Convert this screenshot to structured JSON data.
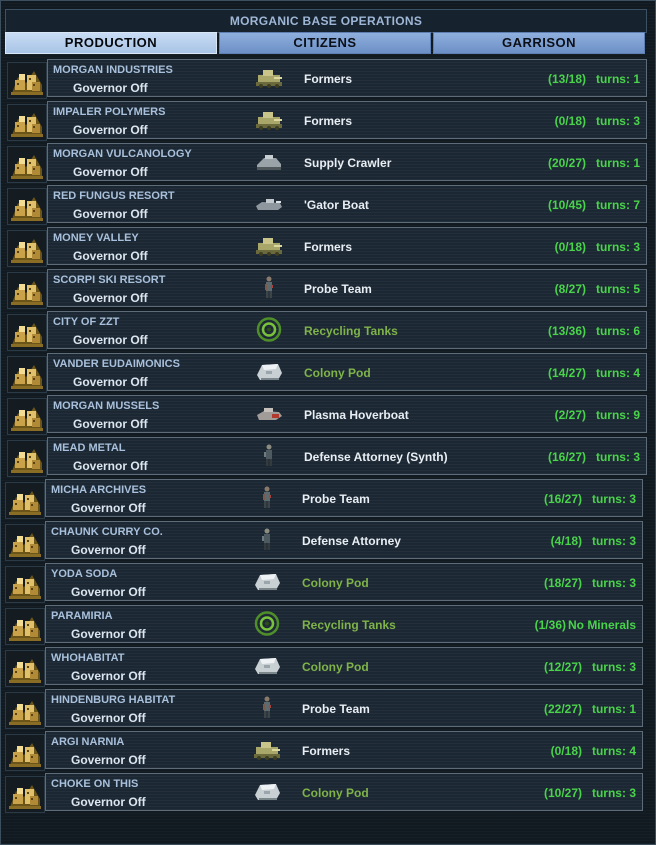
{
  "window": {
    "title": "MORGANIC BASE OPERATIONS"
  },
  "tabs": [
    {
      "label": "PRODUCTION",
      "active": true
    },
    {
      "label": "CITIZENS",
      "active": false
    },
    {
      "label": "GARRISON",
      "active": false
    }
  ],
  "bases": [
    {
      "name": "MORGAN INDUSTRIES",
      "governor": "Governor Off",
      "item": "Formers",
      "item_icon": "formers-icon",
      "facility": false,
      "progress": "(13/18)",
      "turns": "turns:  1"
    },
    {
      "name": "IMPALER POLYMERS",
      "governor": "Governor Off",
      "item": "Formers",
      "item_icon": "formers-icon",
      "facility": false,
      "progress": "(0/18)",
      "turns": "turns:  3"
    },
    {
      "name": "MORGAN VULCANOLOGY",
      "governor": "Governor Off",
      "item": "Supply Crawler",
      "item_icon": "supply-crawler-icon",
      "facility": false,
      "progress": "(20/27)",
      "turns": "turns:  1"
    },
    {
      "name": "RED FUNGUS RESORT",
      "governor": "Governor Off",
      "item": "'Gator Boat",
      "item_icon": "gator-boat-icon",
      "facility": false,
      "progress": "(10/45)",
      "turns": "turns:  7"
    },
    {
      "name": "MONEY VALLEY",
      "governor": "Governor Off",
      "item": "Formers",
      "item_icon": "formers-icon",
      "facility": false,
      "progress": "(0/18)",
      "turns": "turns:  3"
    },
    {
      "name": "SCORPI SKI RESORT",
      "governor": "Governor Off",
      "item": "Probe Team",
      "item_icon": "probe-team-icon",
      "facility": false,
      "progress": "(8/27)",
      "turns": "turns:  5"
    },
    {
      "name": "CITY OF ZZT",
      "governor": "Governor Off",
      "item": "Recycling Tanks",
      "item_icon": "recycling-tanks-icon",
      "facility": true,
      "progress": "(13/36)",
      "turns": "turns:  6"
    },
    {
      "name": "VANDER EUDAIMONICS",
      "governor": "Governor Off",
      "item": "Colony Pod",
      "item_icon": "colony-pod-icon",
      "facility": true,
      "progress": "(14/27)",
      "turns": "turns:  4"
    },
    {
      "name": "MORGAN MUSSELS",
      "governor": "Governor Off",
      "item": "Plasma Hoverboat",
      "item_icon": "hoverboat-icon",
      "facility": false,
      "progress": "(2/27)",
      "turns": "turns:  9"
    },
    {
      "name": "MEAD METAL",
      "governor": "Governor Off",
      "item": "Defense Attorney (Synth)",
      "item_icon": "defense-attorney-icon",
      "facility": false,
      "progress": "(16/27)",
      "turns": "turns:  3"
    },
    {
      "name": "MICHA ARCHIVES",
      "governor": "Governor Off",
      "item": "Probe Team",
      "item_icon": "probe-team-icon",
      "facility": false,
      "progress": "(16/27)",
      "turns": "turns:  3"
    },
    {
      "name": "CHAUNK CURRY CO.",
      "governor": "Governor Off",
      "item": "Defense Attorney",
      "item_icon": "defense-attorney-icon",
      "facility": false,
      "progress": "(4/18)",
      "turns": "turns:  3"
    },
    {
      "name": "YODA SODA",
      "governor": "Governor Off",
      "item": "Colony Pod",
      "item_icon": "colony-pod-icon",
      "facility": true,
      "progress": "(18/27)",
      "turns": "turns:  3"
    },
    {
      "name": "PARAMIRIA",
      "governor": "Governor Off",
      "item": "Recycling Tanks",
      "item_icon": "recycling-tanks-icon",
      "facility": true,
      "progress": "(1/36)",
      "turns": "No Minerals"
    },
    {
      "name": "WHOHABITAT",
      "governor": "Governor Off",
      "item": "Colony Pod",
      "item_icon": "colony-pod-icon",
      "facility": true,
      "progress": "(12/27)",
      "turns": "turns:  3"
    },
    {
      "name": "HINDENBURG HABITAT",
      "governor": "Governor Off",
      "item": "Probe Team",
      "item_icon": "probe-team-icon",
      "facility": false,
      "progress": "(22/27)",
      "turns": "turns:  1"
    },
    {
      "name": "ARGI NARNIA",
      "governor": "Governor Off",
      "item": "Formers",
      "item_icon": "formers-icon",
      "facility": false,
      "progress": "(0/18)",
      "turns": "turns:  4"
    },
    {
      "name": "CHOKE ON THIS",
      "governor": "Governor Off",
      "item": "Colony Pod",
      "item_icon": "colony-pod-icon",
      "facility": true,
      "progress": "(10/27)",
      "turns": "turns:  3"
    }
  ],
  "colors": {
    "accent_green": "#49d34b",
    "facility_text": "#7fb34a",
    "tab_active": "#c8dcf4",
    "tab_inactive": "#7a9ed3",
    "name_text": "#a8c0db"
  }
}
